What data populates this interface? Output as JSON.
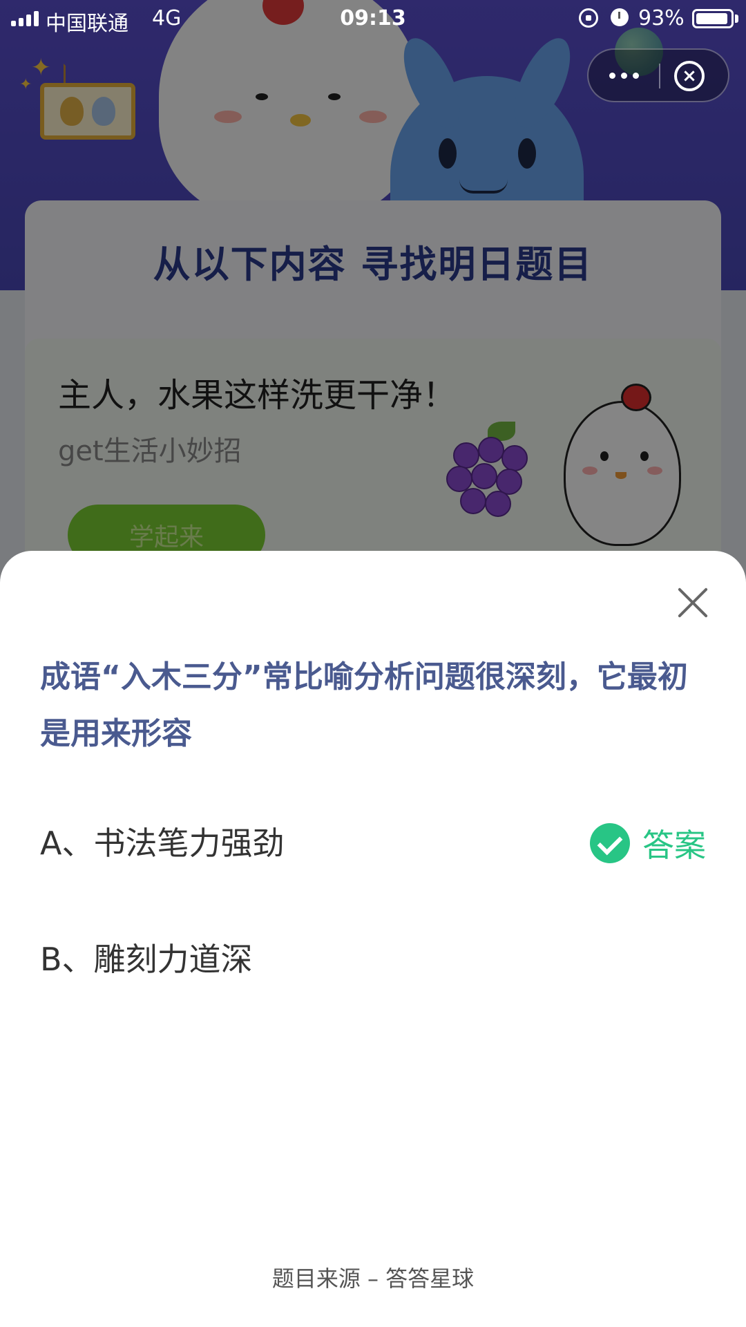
{
  "status_bar": {
    "carrier": "中国联通",
    "network": "4G",
    "time": "09:13",
    "battery_percent": "93%",
    "battery_level": 0.93
  },
  "background": {
    "card_title": "从以下内容  寻找明日题目",
    "promo": {
      "title": "主人，水果这样洗更干净！",
      "subtitle": "get生活小妙招",
      "button_label": "学起来"
    }
  },
  "quiz": {
    "question": "成语“入木三分”常比喻分析问题很深刻，它最初是用来形容",
    "options": [
      {
        "label": "A、书法笔力强劲",
        "is_answer": true
      },
      {
        "label": "B、雕刻力道深",
        "is_answer": false
      }
    ],
    "answer_label": "答案",
    "source": "题目来源 – 答答星球"
  },
  "colors": {
    "accent_green": "#28c585",
    "question_text": "#4a5a8f",
    "promo_button": "#7bcf32"
  },
  "icons": {
    "close": "close-icon",
    "check": "check-circle-icon",
    "more": "more-dots-icon",
    "exit": "exit-circle-icon"
  }
}
